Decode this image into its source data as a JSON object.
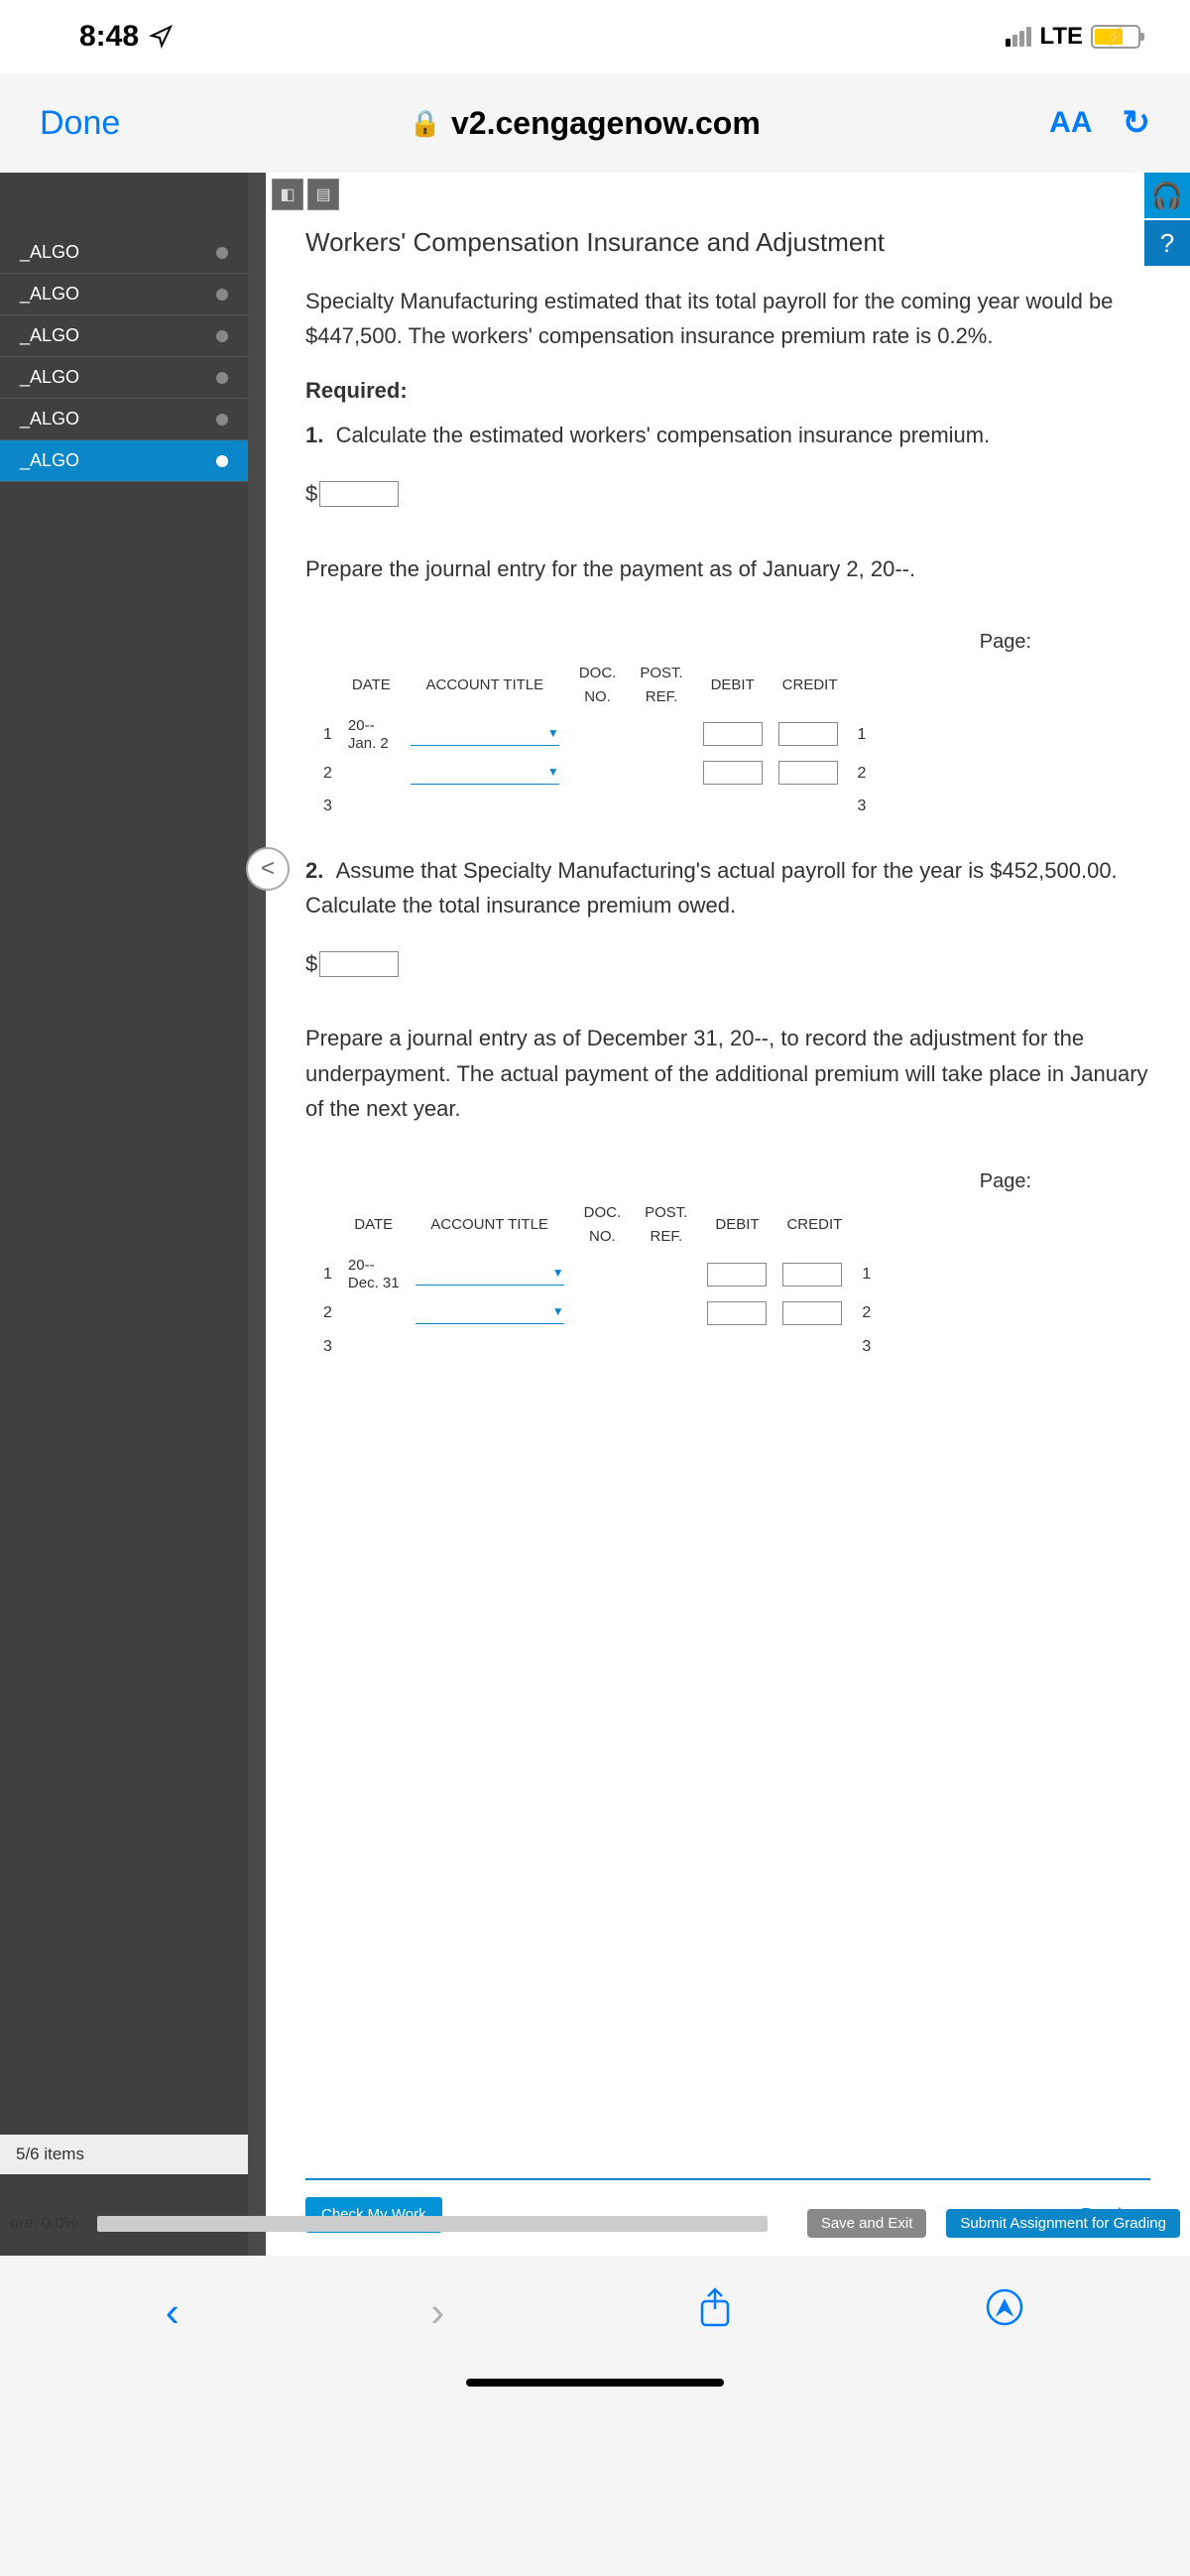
{
  "status": {
    "time": "8:48",
    "network": "LTE"
  },
  "browser": {
    "done": "Done",
    "url": "v2.cengagenow.com",
    "aa": "AA"
  },
  "sidebar": {
    "items": [
      {
        "label": "_ALGO"
      },
      {
        "label": "_ALGO"
      },
      {
        "label": "_ALGO"
      },
      {
        "label": "_ALGO"
      },
      {
        "label": "_ALGO"
      },
      {
        "label": "_ALGO"
      }
    ]
  },
  "content": {
    "title": "Workers' Compensation Insurance and Adjustment",
    "intro": "Specialty Manufacturing estimated that its total payroll for the coming year would be $447,500. The workers' compensation insurance premium rate is 0.2%.",
    "required": "Required:",
    "q1_prefix": "1.",
    "q1_text": "Calculate the estimated workers' compensation insurance premium.",
    "dollar": "$",
    "prep1": "Prepare the journal entry for the payment as of January 2, 20--.",
    "page": "Page:",
    "headers": {
      "date": "DATE",
      "acct": "ACCOUNT TITLE",
      "docno": "DOC.\nNO.",
      "postref": "POST.\nREF.",
      "debit": "DEBIT",
      "credit": "CREDIT"
    },
    "table1": {
      "r1": {
        "num": "1",
        "date": "20--\nJan. 2",
        "end": "1"
      },
      "r2": {
        "num": "2",
        "end": "2"
      },
      "r3": {
        "num": "3",
        "end": "3"
      }
    },
    "q2_prefix": "2.",
    "q2_text": "Assume that Specialty Manufacturing's actual payroll for the year is $452,500.00. Calculate the total insurance premium owed.",
    "prep2": "Prepare a journal entry as of December 31, 20--, to record the adjustment for the underpayment. The actual payment of the additional premium will take place in January of the next year.",
    "table2": {
      "r1": {
        "num": "1",
        "date": "20--\nDec. 31",
        "end": "1"
      },
      "r2": {
        "num": "2",
        "end": "2"
      },
      "r3": {
        "num": "3",
        "end": "3"
      }
    }
  },
  "buttons": {
    "check": "Check My Work",
    "previous": "Previous",
    "items": "5/6 items",
    "score": "ore: 0.0%",
    "save_exit": "Save and Exit",
    "submit": "Submit Assignment for Grading"
  }
}
